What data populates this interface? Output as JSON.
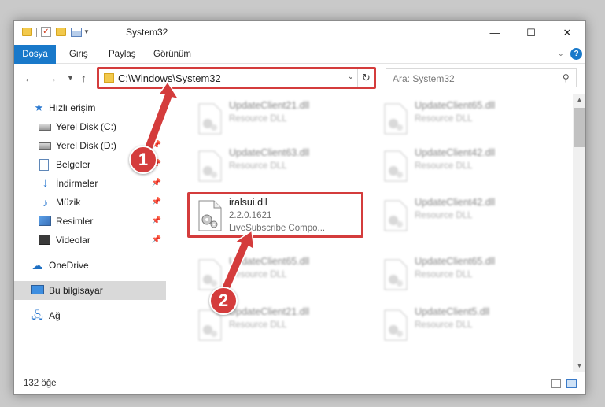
{
  "window": {
    "title": "System32",
    "minimize": "—",
    "maximize": "☐",
    "close": "✕"
  },
  "ribbon": {
    "tabs": [
      "Dosya",
      "Giriş",
      "Paylaş",
      "Görünüm"
    ],
    "help": "?"
  },
  "address": {
    "path": "C:\\Windows\\System32",
    "search_placeholder": "Ara: System32"
  },
  "sidebar": {
    "items": [
      {
        "label": "Hızlı erişim",
        "icon": "star-icon",
        "pinned": false
      },
      {
        "label": "Yerel Disk (C:)",
        "icon": "drive-icon",
        "pinned": true
      },
      {
        "label": "Yerel Disk (D:)",
        "icon": "drive-icon",
        "pinned": true
      },
      {
        "label": "Belgeler",
        "icon": "document-icon",
        "pinned": true
      },
      {
        "label": "İndirmeler",
        "icon": "download-icon",
        "pinned": true
      },
      {
        "label": "Müzik",
        "icon": "music-icon",
        "pinned": true
      },
      {
        "label": "Resimler",
        "icon": "pictures-icon",
        "pinned": true
      },
      {
        "label": "Videolar",
        "icon": "video-icon",
        "pinned": true
      },
      {
        "label": "OneDrive",
        "icon": "cloud-icon",
        "pinned": false
      },
      {
        "label": "Bu bilgisayar",
        "icon": "computer-icon",
        "pinned": false,
        "selected": true
      },
      {
        "label": "Ağ",
        "icon": "network-icon",
        "pinned": false
      }
    ]
  },
  "files": {
    "col1": [
      {
        "name": "UpdateClient21.dll",
        "desc": "Resource DLL",
        "blurred": true
      },
      {
        "name": "UpdateClient63.dll",
        "desc": "Resource DLL",
        "blurred": true
      },
      {
        "name": "iralsui.dll",
        "version": "2.2.0.1621",
        "desc": "LiveSubscribe Compo...",
        "blurred": false,
        "highlighted": true
      },
      {
        "name": "UpdateClient65.dll",
        "desc": "Resource DLL",
        "blurred": true
      },
      {
        "name": "UpdateClient21.dll",
        "desc": "Resource DLL",
        "blurred": true
      }
    ],
    "col2": [
      {
        "name": "UpdateClient65.dll",
        "desc": "Resource DLL",
        "blurred": true
      },
      {
        "name": "UpdateClient42.dll",
        "desc": "Resource DLL",
        "blurred": true
      },
      {
        "name": "UpdateClient42.dll",
        "desc": "Resource DLL",
        "blurred": true
      },
      {
        "name": "UpdateClient65.dll",
        "desc": "Resource DLL",
        "blurred": true
      },
      {
        "name": "UpdateClient5.dll",
        "desc": "Resource DLL",
        "blurred": true
      }
    ]
  },
  "status": {
    "item_count": "132 öğe"
  },
  "annotations": {
    "step1": "1",
    "step2": "2",
    "color": "#d43c3c"
  },
  "colors": {
    "accent": "#1979ca",
    "highlight": "#d43c3c",
    "selected_bg": "#d9d9d9"
  }
}
